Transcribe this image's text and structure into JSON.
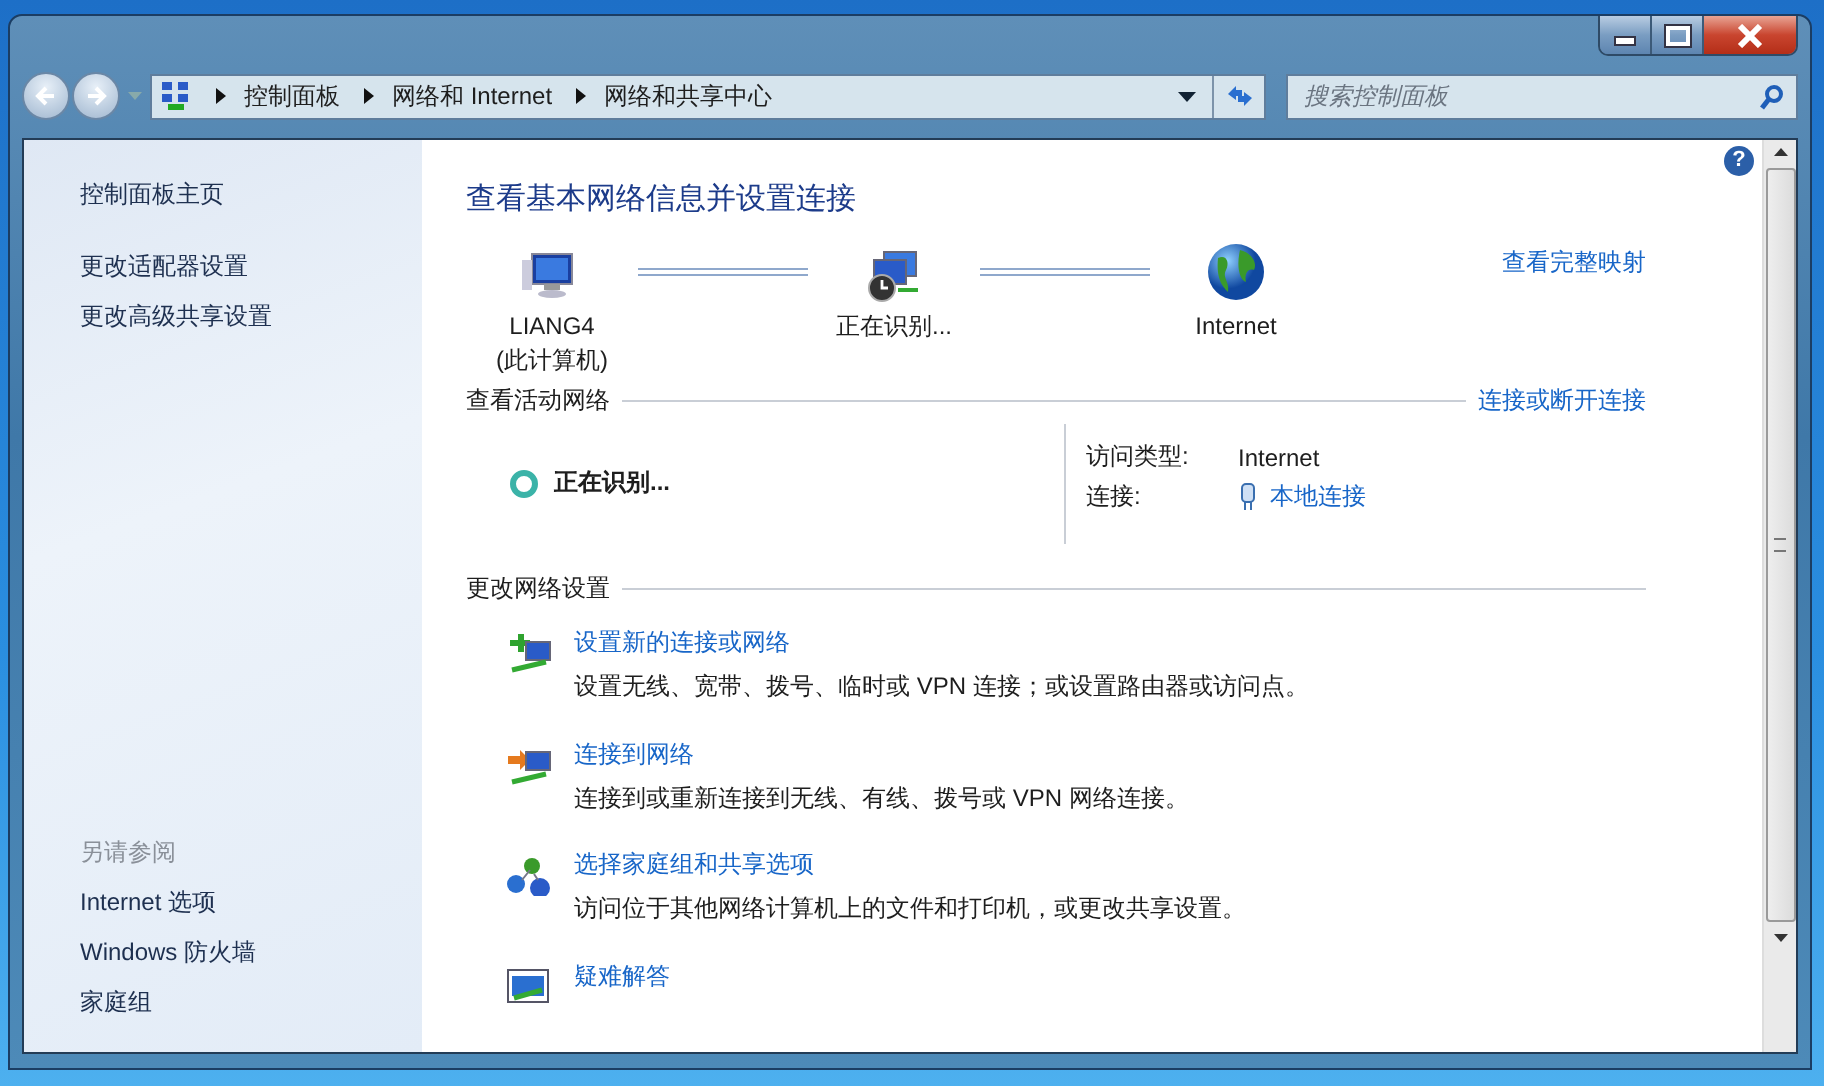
{
  "address_bar": {
    "breadcrumbs": [
      "控制面板",
      "网络和 Internet",
      "网络和共享中心"
    ]
  },
  "search": {
    "placeholder": "搜索控制面板"
  },
  "help": "?",
  "sidebar": {
    "items": [
      "控制面板主页",
      "更改适配器设置",
      "更改高级共享设置"
    ],
    "see_also": {
      "title": "另请参阅",
      "items": [
        "Internet 选项",
        "Windows 防火墙",
        "家庭组"
      ]
    }
  },
  "main": {
    "title": "查看基本网络信息并设置连接",
    "map_link": "查看完整映射",
    "map_nodes": [
      {
        "kind": "computer",
        "label": "LIANG4",
        "sublabel": "(此计算机)"
      },
      {
        "kind": "identifying",
        "label": "正在识别..."
      },
      {
        "kind": "internet",
        "label": "Internet"
      }
    ],
    "active_networks": {
      "title": "查看活动网络",
      "link": "连接或断开连接",
      "network_name": "正在识别...",
      "rows": [
        {
          "label": "访问类型:",
          "value": "Internet",
          "kind": "text"
        },
        {
          "label": "连接:",
          "value": "本地连接",
          "kind": "link"
        }
      ]
    },
    "change_settings": {
      "title": "更改网络设置",
      "tasks": [
        {
          "kind": "new",
          "title": "设置新的连接或网络",
          "description": "设置无线、宽带、拨号、临时或 VPN 连接；或设置路由器或访问点。"
        },
        {
          "kind": "connect",
          "title": "连接到网络",
          "description": "连接到或重新连接到无线、有线、拨号或 VPN 网络连接。"
        },
        {
          "kind": "homegroup",
          "title": "选择家庭组和共享选项",
          "description": "访问位于其他网络计算机上的文件和打印机，或更改共享设置。"
        },
        {
          "kind": "troubleshoot",
          "title": "疑难解答"
        }
      ]
    }
  }
}
